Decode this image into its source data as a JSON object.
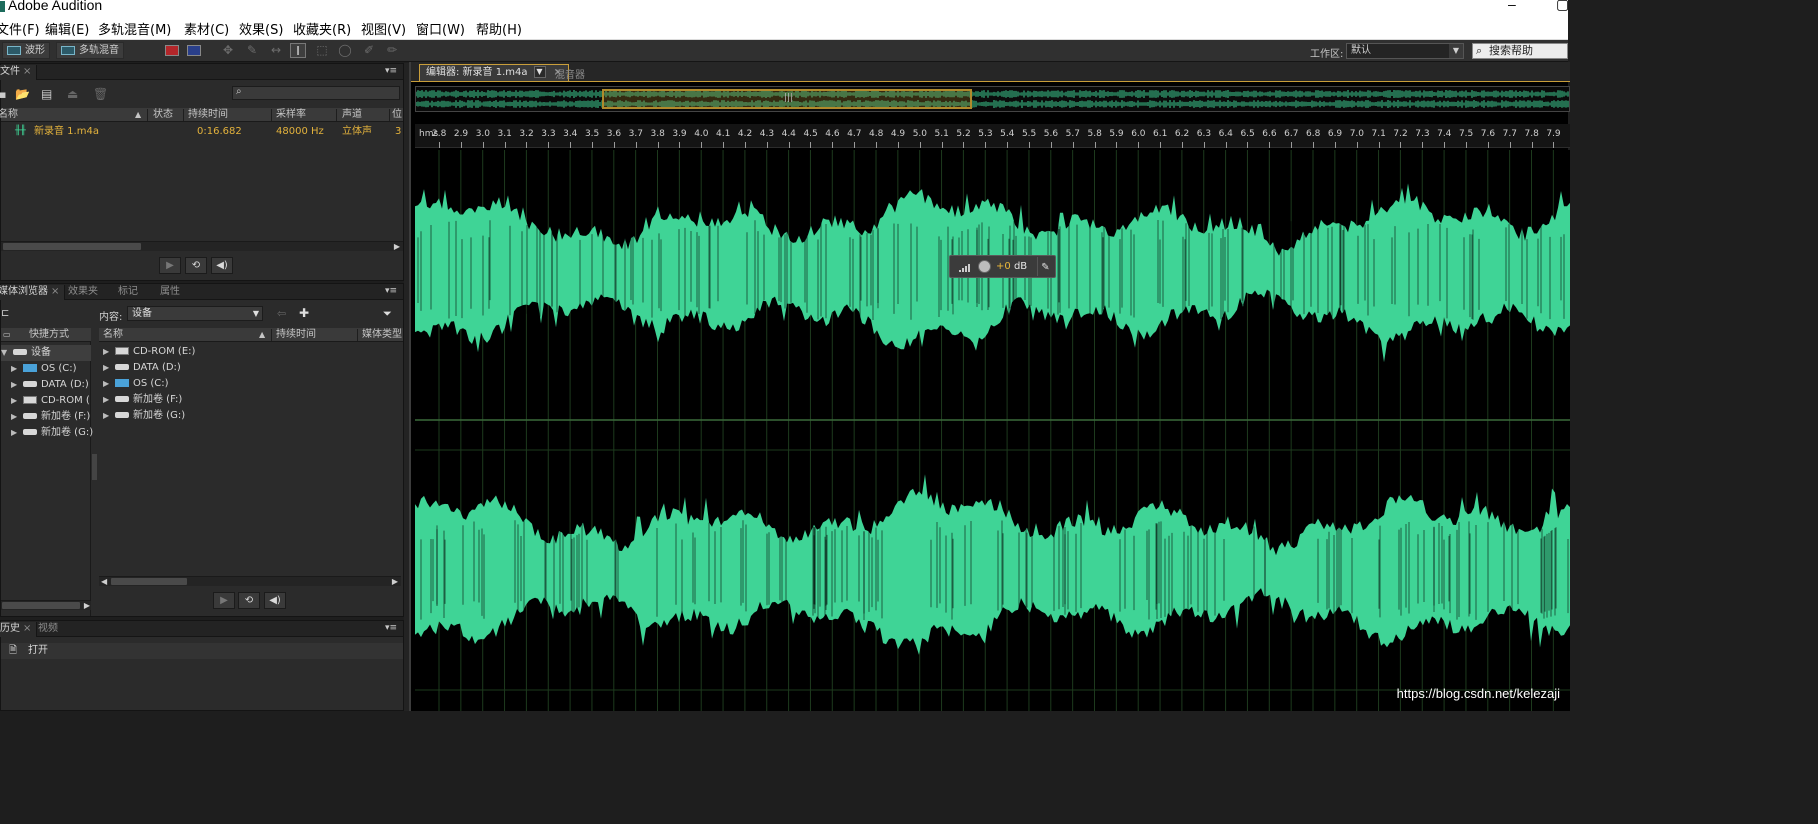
{
  "window": {
    "title": "Adobe Audition",
    "minimize": "–",
    "maximize": "▢"
  },
  "menu": [
    "文件(F)",
    "编辑(E)",
    "多轨混音(M)",
    "素材(C)",
    "效果(S)",
    "收藏夹(R)",
    "视图(V)",
    "窗口(W)",
    "帮助(H)"
  ],
  "toolbar": {
    "waveform_label": "波形",
    "multitrack_label": "多轨混音",
    "workspace_label": "工作区:",
    "workspace_value": "默认",
    "help_search": "搜索帮助"
  },
  "files_panel": {
    "tab": "文件",
    "columns": [
      "名称",
      "状态",
      "持续时间",
      "采样率",
      "声道",
      "位"
    ],
    "files": [
      {
        "name": "新录音 1.m4a",
        "status": "",
        "duration": "0:16.682",
        "sample_rate": "48000 Hz",
        "channels": "立体声",
        "bits": "3"
      }
    ]
  },
  "media_panel": {
    "tabs": [
      "媒体浏览器",
      "效果夹",
      "标记",
      "属性"
    ],
    "content_label": "内容:",
    "content_value": "设备",
    "shortcuts_label": "快捷方式",
    "left_tree": [
      {
        "label": "设备",
        "level": 0
      },
      {
        "label": "OS (C:)",
        "level": 1
      },
      {
        "label": "DATA (D:)",
        "level": 1
      },
      {
        "label": "CD-ROM (",
        "level": 1
      },
      {
        "label": "新加卷 (F:)",
        "level": 1
      },
      {
        "label": "新加卷 (G:)",
        "level": 1
      }
    ],
    "columns": [
      "名称",
      "持续时间",
      "媒体类型"
    ],
    "items": [
      "CD-ROM (E:)",
      "DATA (D:)",
      "OS (C:)",
      "新加卷 (F:)",
      "新加卷 (G:)"
    ]
  },
  "history_panel": {
    "tabs": [
      "历史",
      "视频"
    ],
    "items": [
      "打开"
    ]
  },
  "editor": {
    "tab": "编辑器: 新录音 1.m4a",
    "mixer_tab": "混音器",
    "ruler_unit": "hms",
    "ruler_ticks": [
      "2.8",
      "2.9",
      "3.0",
      "3.1",
      "3.2",
      "3.3",
      "3.4",
      "3.5",
      "3.6",
      "3.7",
      "3.8",
      "3.9",
      "4.0",
      "4.1",
      "4.2",
      "4.3",
      "4.4",
      "4.5",
      "4.6",
      "4.7",
      "4.8",
      "4.9",
      "5.0",
      "5.1",
      "5.2",
      "5.3",
      "5.4",
      "5.5",
      "5.6",
      "5.7",
      "5.8",
      "5.9",
      "6.0",
      "6.1",
      "6.2",
      "6.3",
      "6.4",
      "6.5",
      "6.6",
      "6.7",
      "6.8",
      "6.9",
      "7.0",
      "7.1",
      "7.2",
      "7.3",
      "7.4",
      "7.5",
      "7.6",
      "7.7",
      "7.8",
      "7.9"
    ],
    "gain": {
      "value": "+0",
      "unit": "dB"
    },
    "waveform_color": "#3fd496",
    "selection_color": "#b08a2c"
  },
  "watermark": "https://blog.csdn.net/kelezaji"
}
